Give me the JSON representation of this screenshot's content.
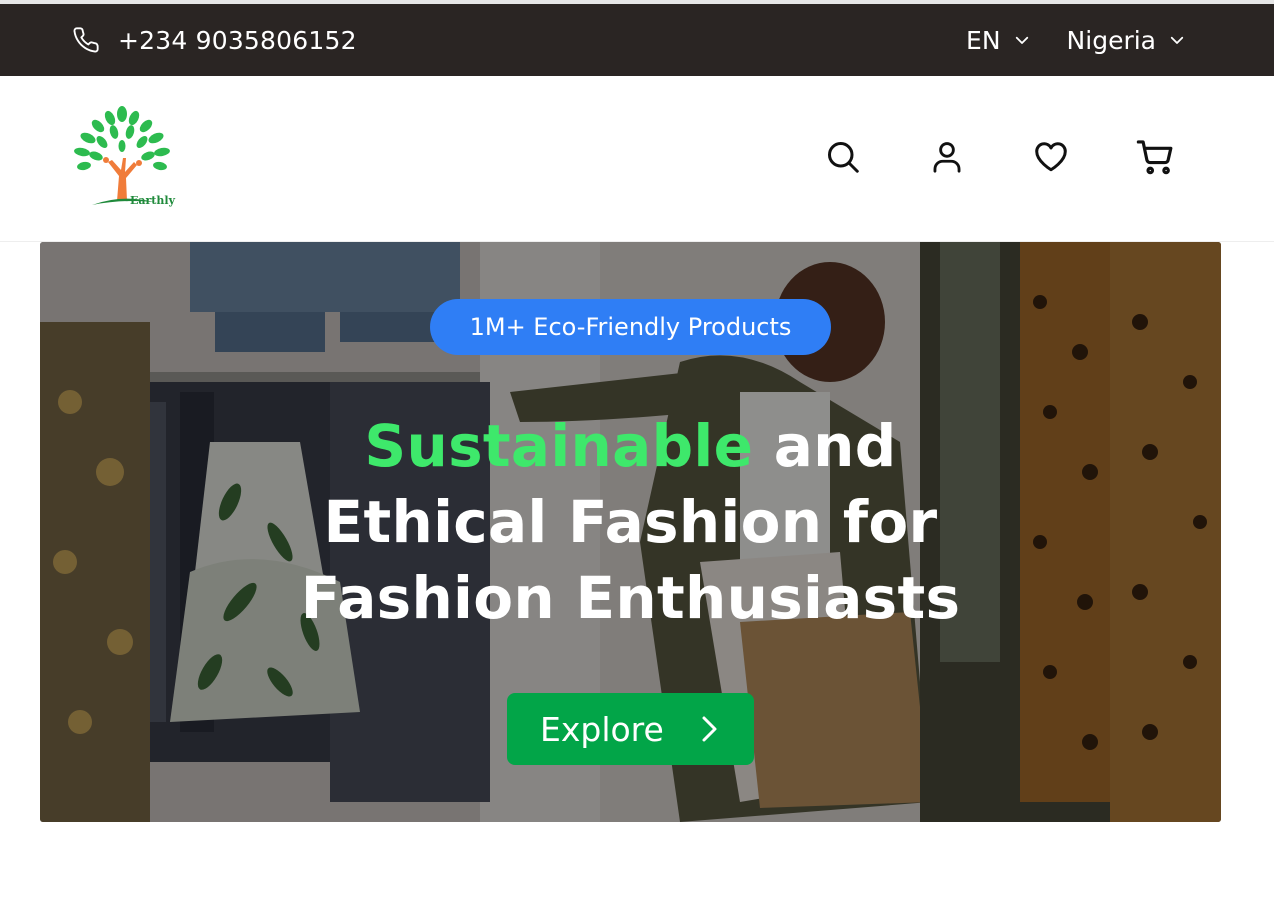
{
  "topbar": {
    "phone": "+234 9035806152",
    "phone_icon": "phone-icon",
    "language": "EN",
    "country": "Nigeria",
    "background": "#2a2523"
  },
  "header": {
    "logo_text": "Earthly",
    "icons": [
      "search-icon",
      "user-icon",
      "heart-icon",
      "cart-icon"
    ]
  },
  "hero": {
    "badge": "1M+ Eco-Friendly Products",
    "headline_highlight": "Sustainable",
    "headline_line1_rest": " and",
    "headline_line2": "Ethical Fashion for",
    "headline_line3": "Fashion Enthusiasts",
    "cta_label": "Explore",
    "colors": {
      "badge": "#2f7ef5",
      "highlight": "#3ee86b",
      "cta": "#02a548"
    }
  }
}
